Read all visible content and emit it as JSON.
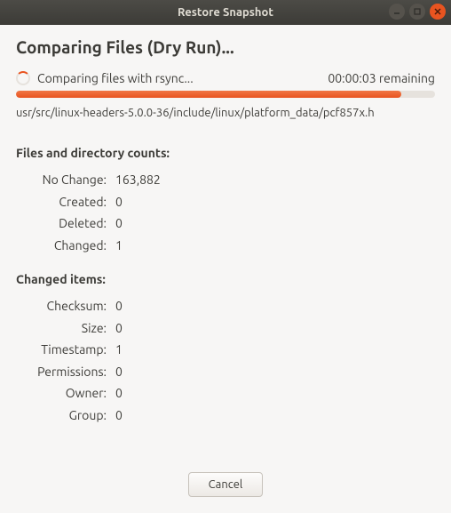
{
  "window": {
    "title": "Restore Snapshot"
  },
  "heading": "Comparing Files (Dry Run)...",
  "status": {
    "text": "Comparing files with rsync...",
    "remaining": "00:00:03 remaining"
  },
  "current_path": "usr/src/linux-headers-5.0.0-36/include/linux/platform_data/pcf857x.h",
  "sections": {
    "counts_title": "Files and directory counts:",
    "changed_title": "Changed items:"
  },
  "counts": {
    "no_change": {
      "label": "No Change:",
      "value": "163,882"
    },
    "created": {
      "label": "Created:",
      "value": "0"
    },
    "deleted": {
      "label": "Deleted:",
      "value": "0"
    },
    "changed": {
      "label": "Changed:",
      "value": "1"
    }
  },
  "changed_items": {
    "checksum": {
      "label": "Checksum:",
      "value": "0"
    },
    "size": {
      "label": "Size:",
      "value": "0"
    },
    "timestamp": {
      "label": "Timestamp:",
      "value": "1"
    },
    "permissions": {
      "label": "Permissions:",
      "value": "0"
    },
    "owner": {
      "label": "Owner:",
      "value": "0"
    },
    "group": {
      "label": "Group:",
      "value": "0"
    }
  },
  "buttons": {
    "cancel": "Cancel"
  }
}
